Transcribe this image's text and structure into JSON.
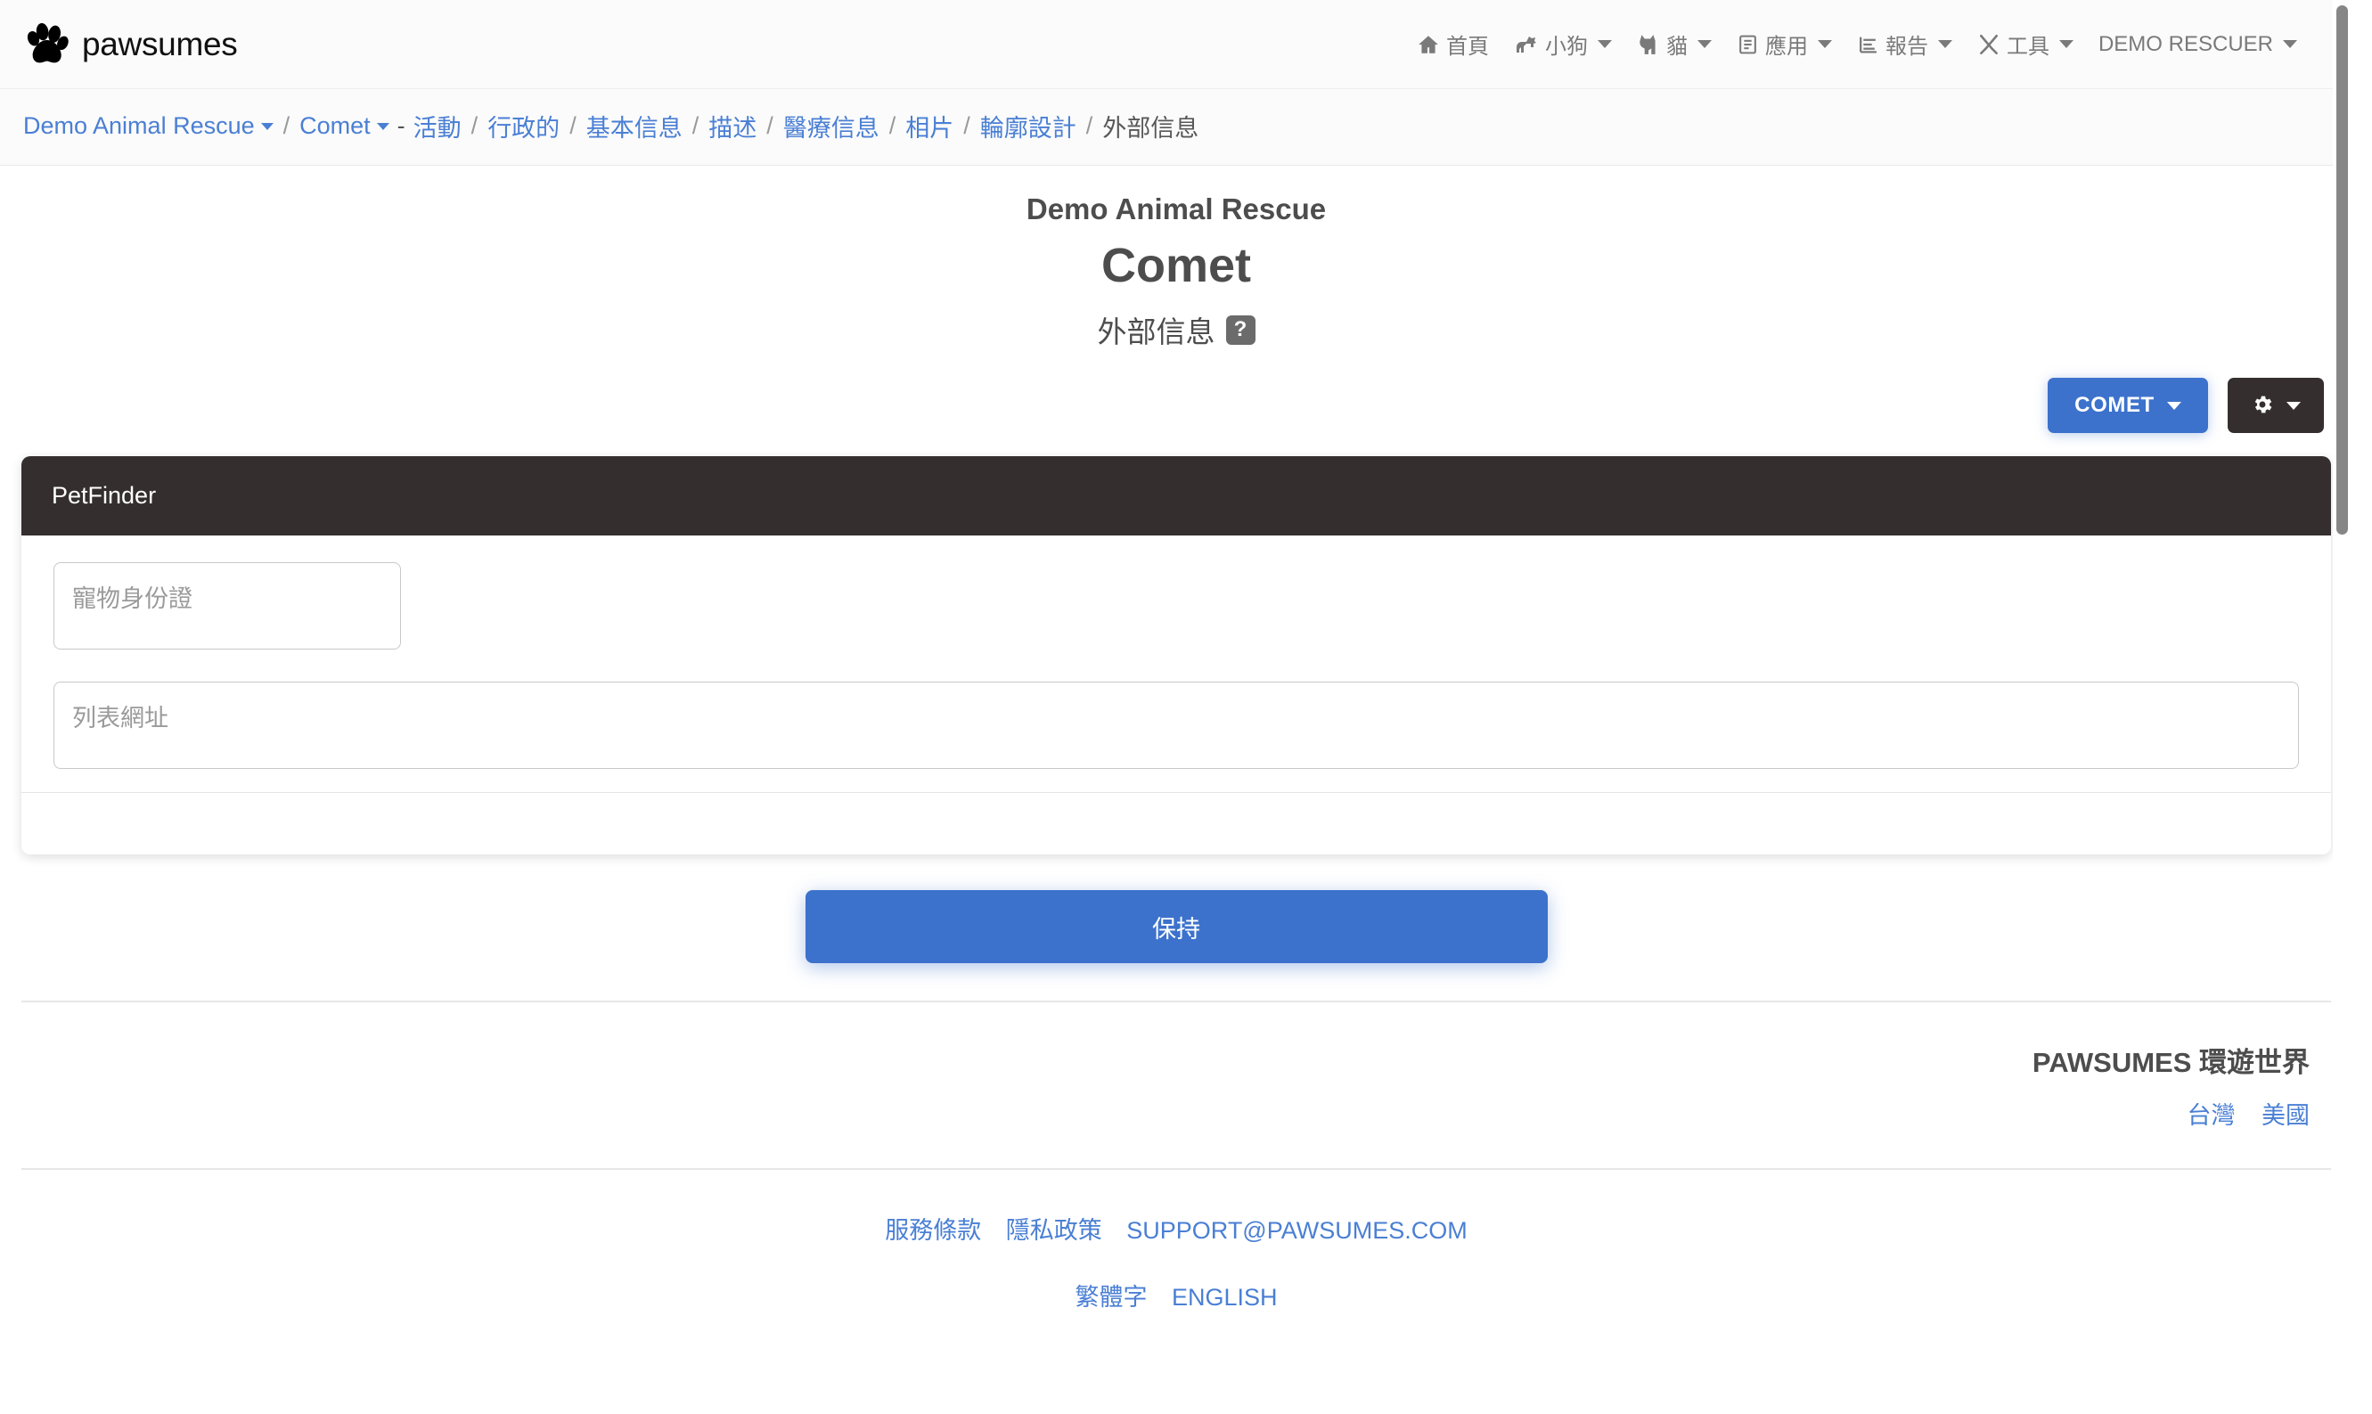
{
  "brand": {
    "name": "pawsumes",
    "logo_icon": "paw-icon"
  },
  "nav": {
    "items": [
      {
        "label": "首頁",
        "icon": "home-icon",
        "has_caret": false
      },
      {
        "label": "小狗",
        "icon": "dog-icon",
        "has_caret": true
      },
      {
        "label": "貓",
        "icon": "cat-icon",
        "has_caret": true
      },
      {
        "label": "應用",
        "icon": "clipboard-icon",
        "has_caret": true
      },
      {
        "label": "報告",
        "icon": "bar-chart-icon",
        "has_caret": true
      },
      {
        "label": "工具",
        "icon": "tools-icon",
        "has_caret": true
      },
      {
        "label": "DEMO RESCUER",
        "icon": "",
        "has_caret": true
      }
    ]
  },
  "breadcrumb": {
    "items": [
      {
        "label": "Demo Animal Rescue",
        "caret": true,
        "current": false,
        "sep": "/"
      },
      {
        "label": "Comet",
        "caret": true,
        "current": false,
        "sep": "-"
      },
      {
        "label": "活動",
        "caret": false,
        "current": false,
        "sep": "/"
      },
      {
        "label": "行政的",
        "caret": false,
        "current": false,
        "sep": "/"
      },
      {
        "label": "基本信息",
        "caret": false,
        "current": false,
        "sep": "/"
      },
      {
        "label": "描述",
        "caret": false,
        "current": false,
        "sep": "/"
      },
      {
        "label": "醫療信息",
        "caret": false,
        "current": false,
        "sep": "/"
      },
      {
        "label": "相片",
        "caret": false,
        "current": false,
        "sep": "/"
      },
      {
        "label": "輪廓設計",
        "caret": false,
        "current": false,
        "sep": "/"
      },
      {
        "label": "外部信息",
        "caret": false,
        "current": true,
        "sep": ""
      }
    ]
  },
  "heading": {
    "organization": "Demo Animal Rescue",
    "animal_name": "Comet",
    "section": "外部信息",
    "help_badge": "?"
  },
  "actions": {
    "animal_menu_label": "COMET",
    "settings_icon": "gear-icon"
  },
  "card": {
    "title": "PetFinder",
    "fields": {
      "pet_id_placeholder": "寵物身份證",
      "pet_id_value": "",
      "listing_url_placeholder": "列表網址",
      "listing_url_value": ""
    }
  },
  "save": {
    "label": "保持"
  },
  "footer": {
    "brand_line": "PAWSUMES 環遊世界",
    "countries": [
      "台灣",
      "美國"
    ],
    "links": [
      "服務條款",
      "隱私政策",
      "SUPPORT@PAWSUMES.COM"
    ],
    "languages": [
      "繁體字",
      "ENGLISH"
    ]
  },
  "colors": {
    "accent_blue": "#3c72cc",
    "link_blue": "#4a7fd4",
    "dark": "#342f2e",
    "text_gray": "#4d4d4d"
  }
}
